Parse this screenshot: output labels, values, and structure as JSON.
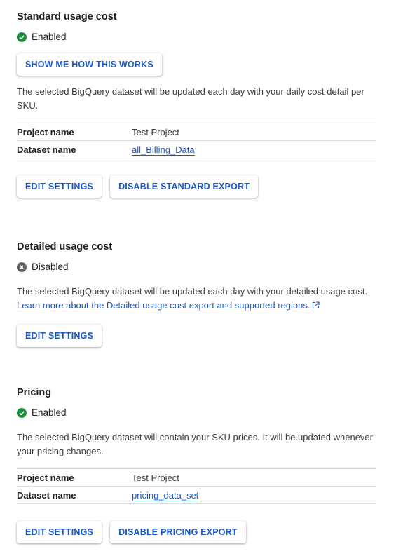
{
  "standard": {
    "title": "Standard usage cost",
    "status": "Enabled",
    "show_button": "SHOW ME HOW THIS WORKS",
    "description": "The selected BigQuery dataset will be updated each day with your daily cost detail per SKU.",
    "rows": [
      {
        "key": "Project name",
        "value": "Test Project"
      },
      {
        "key": "Dataset name",
        "value": "all_Billing_Data"
      }
    ],
    "edit_button": "EDIT SETTINGS",
    "disable_button": "DISABLE STANDARD EXPORT"
  },
  "detailed": {
    "title": "Detailed usage cost",
    "status": "Disabled",
    "description": "The selected BigQuery dataset will be updated each day with your detailed usage cost.",
    "link": "Learn more about the Detailed usage cost export and supported regions.",
    "edit_button": "EDIT SETTINGS"
  },
  "pricing": {
    "title": "Pricing",
    "status": "Enabled",
    "description": "The selected BigQuery dataset will contain your SKU prices. It will be updated whenever your pricing changes.",
    "rows": [
      {
        "key": "Project name",
        "value": "Test Project"
      },
      {
        "key": "Dataset name",
        "value": "pricing_data_set"
      }
    ],
    "edit_button": "EDIT SETTINGS",
    "disable_button": "DISABLE PRICING EXPORT"
  },
  "colors": {
    "link": "#1a57c8",
    "enabled": "#1e8e3e",
    "disabled": "#5f6368",
    "divider": "#dadce0"
  },
  "icons": {
    "enabled": "check-circle-icon",
    "disabled": "x-circle-icon",
    "external": "external-link-icon"
  }
}
